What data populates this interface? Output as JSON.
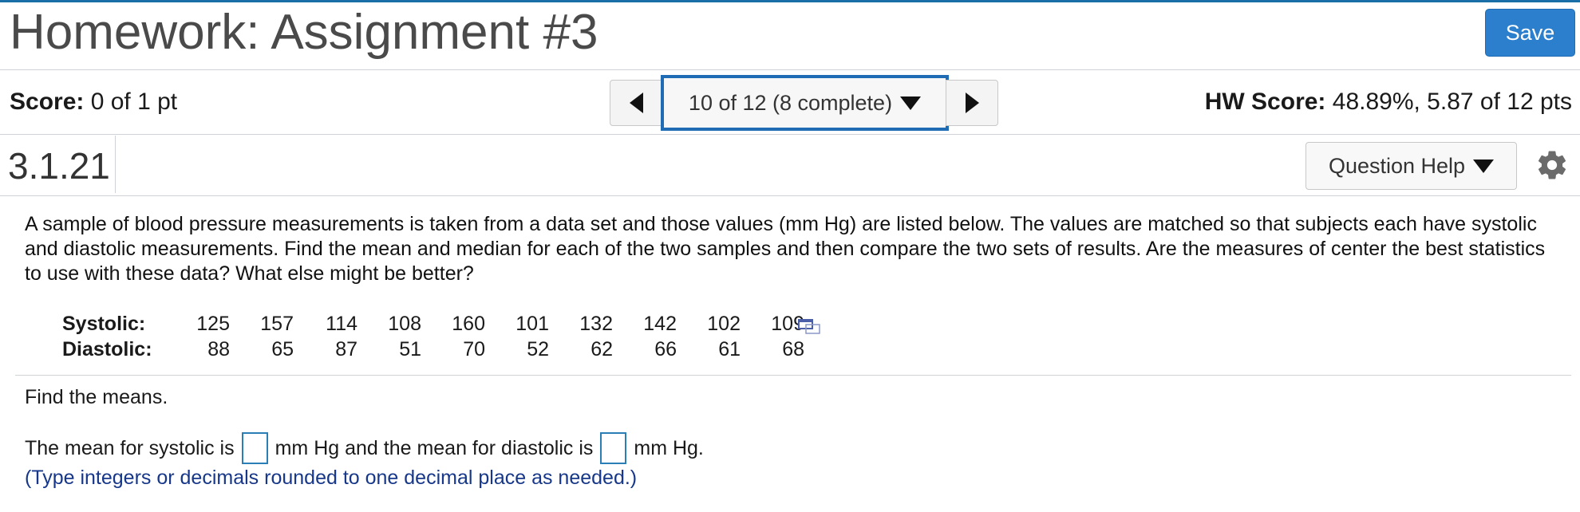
{
  "header": {
    "title": "Homework: Assignment #3",
    "save_label": "Save"
  },
  "scorebar": {
    "score_label": "Score:",
    "score_value": "0 of 1 pt",
    "nav_current": "10 of 12 (8 complete)",
    "hw_score_label": "HW Score:",
    "hw_score_value": "48.89%, 5.87 of 12 pts"
  },
  "question": {
    "number": "3.1.21",
    "help_label": "Question Help"
  },
  "problem_text": "A sample of blood pressure measurements is taken from a data set and those values (mm Hg) are listed below. The values are matched so that subjects each have systolic and diastolic measurements. Find the mean and median for each of the two samples and then compare the two sets of results. Are the measures of center the best statistics to use with these data? What else might be better?",
  "data": {
    "systolic_label": "Systolic:",
    "systolic": [
      "125",
      "157",
      "114",
      "108",
      "160",
      "101",
      "132",
      "142",
      "102",
      "109"
    ],
    "diastolic_label": "Diastolic:",
    "diastolic": [
      "88",
      "65",
      "87",
      "51",
      "70",
      "52",
      "62",
      "66",
      "61",
      "68"
    ]
  },
  "part": {
    "prompt": "Find the means.",
    "sentence_before": "The mean for systolic is",
    "sentence_middle": "mm Hg and the mean for diastolic is",
    "sentence_after": "mm Hg.",
    "hint": "(Type integers or decimals rounded to one decimal place as needed.)"
  },
  "colors": {
    "accent": "#2b7fcd",
    "hint_text": "#16378a",
    "answer_box_border": "#2b7fb6"
  },
  "icons": [
    "triangle-left-icon",
    "triangle-right-icon",
    "dropdown-arrow-icon",
    "gear-icon",
    "data-copy-icon"
  ]
}
